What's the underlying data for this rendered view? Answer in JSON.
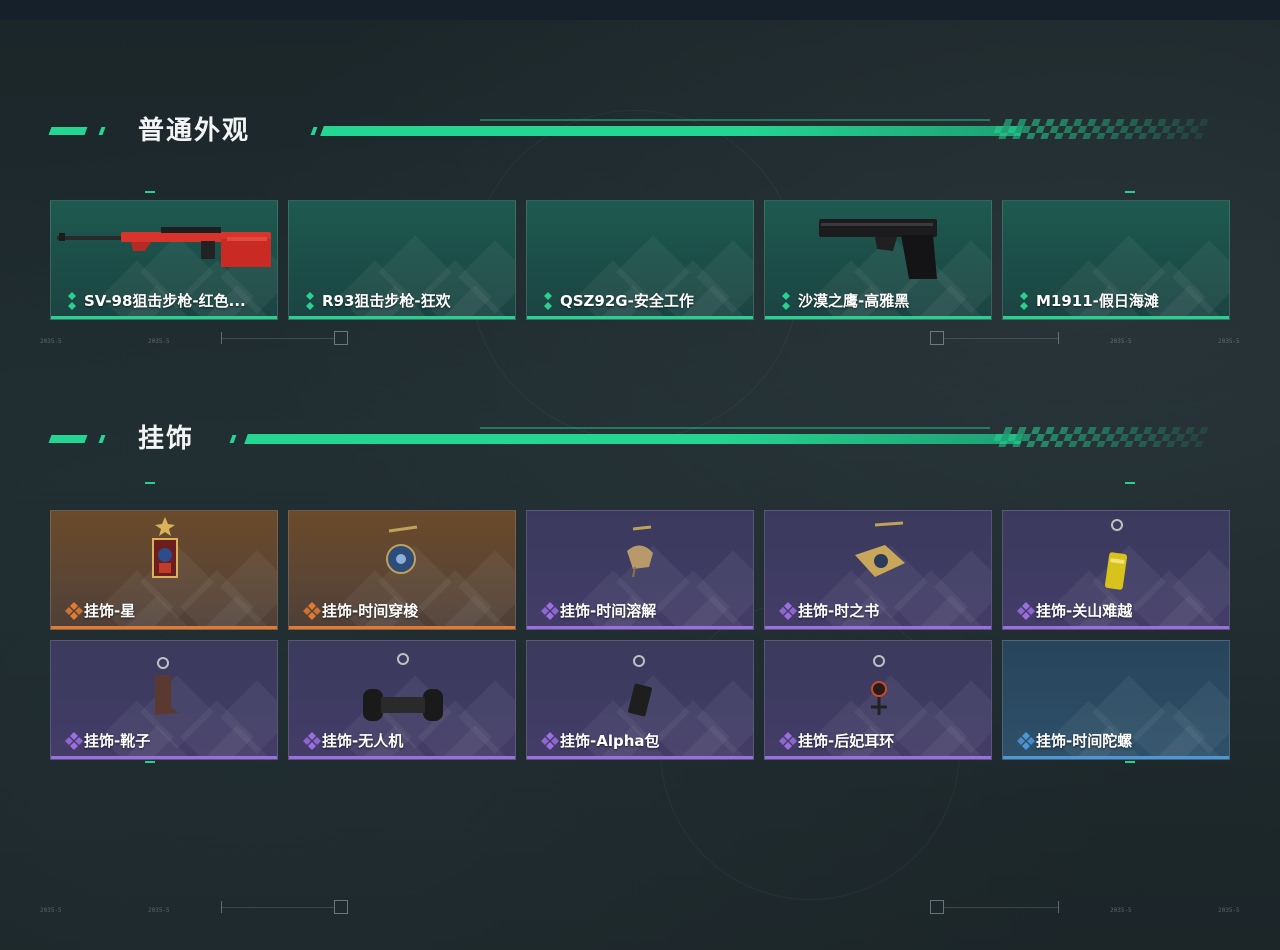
{
  "colors": {
    "accent_green": "#25d692",
    "rarity_green": "#2bd08f",
    "rarity_orange": "#e07a35",
    "rarity_purple": "#9b6fe0",
    "rarity_blue": "#4d97d6"
  },
  "sections": [
    {
      "title": "普通外观",
      "items": [
        {
          "label": "SV-98狙击步枪-红色...",
          "rarity": "green",
          "icon": "sniper-rifle-red-icon"
        },
        {
          "label": "R93狙击步枪-狂欢",
          "rarity": "green",
          "icon": ""
        },
        {
          "label": "QSZ92G-安全工作",
          "rarity": "green",
          "icon": ""
        },
        {
          "label": "沙漠之鹰-高雅黑",
          "rarity": "green",
          "icon": "desert-eagle-black-icon"
        },
        {
          "label": "M1911-假日海滩",
          "rarity": "green",
          "icon": ""
        }
      ]
    },
    {
      "title": "挂饰",
      "items": [
        {
          "label": "挂饰-星",
          "rarity": "orange",
          "icon": "star-charm-icon"
        },
        {
          "label": "挂饰-时间穿梭",
          "rarity": "orange",
          "icon": "time-travel-charm-icon"
        },
        {
          "label": "挂饰-时间溶解",
          "rarity": "purple",
          "icon": "time-dissolve-charm-icon"
        },
        {
          "label": "挂饰-时之书",
          "rarity": "purple",
          "icon": "book-of-time-charm-icon"
        },
        {
          "label": "挂饰-关山难越",
          "rarity": "purple",
          "icon": "yellow-capsule-charm-icon"
        },
        {
          "label": "挂饰-靴子",
          "rarity": "purple",
          "icon": "boot-charm-icon"
        },
        {
          "label": "挂饰-无人机",
          "rarity": "purple",
          "icon": "drone-charm-icon"
        },
        {
          "label": "挂饰-Alpha包",
          "rarity": "purple",
          "icon": "alpha-bag-charm-icon"
        },
        {
          "label": "挂饰-后妃耳环",
          "rarity": "purple",
          "icon": "earring-charm-icon"
        },
        {
          "label": "挂饰-时间陀螺",
          "rarity": "blue",
          "icon": ""
        }
      ]
    }
  ],
  "deco_text": [
    "2035-5",
    "2035-5",
    "2035-5",
    "2035-5"
  ]
}
